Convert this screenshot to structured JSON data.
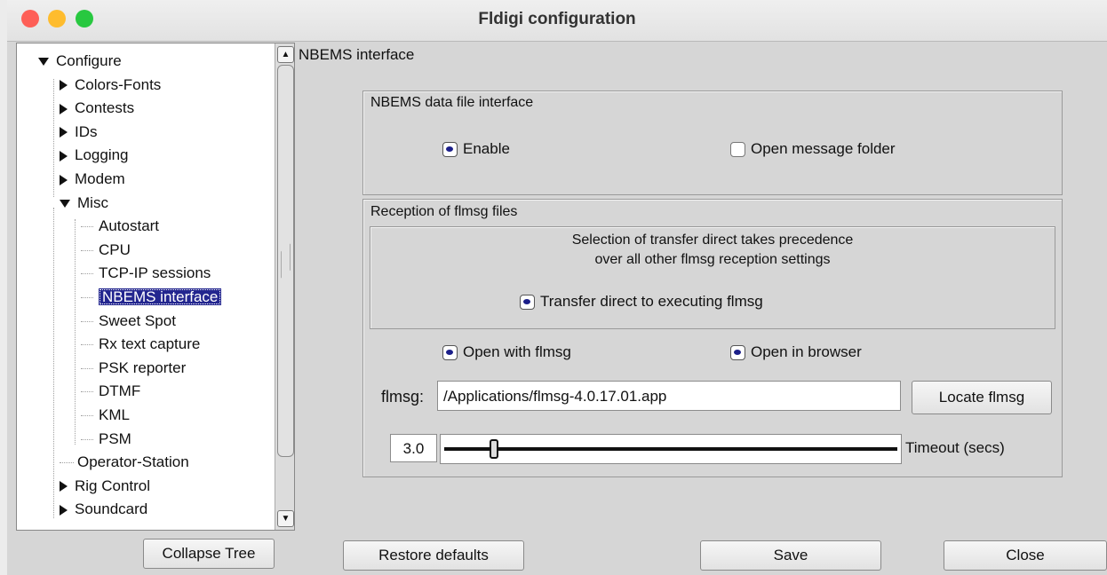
{
  "window": {
    "title": "Fldigi configuration"
  },
  "tree": {
    "items": [
      {
        "label": "Configure",
        "level": 0,
        "expander": "down"
      },
      {
        "label": "Colors-Fonts",
        "level": 1,
        "expander": "right"
      },
      {
        "label": "Contests",
        "level": 1,
        "expander": "right"
      },
      {
        "label": "IDs",
        "level": 1,
        "expander": "right"
      },
      {
        "label": "Logging",
        "level": 1,
        "expander": "right"
      },
      {
        "label": "Modem",
        "level": 1,
        "expander": "right"
      },
      {
        "label": "Misc",
        "level": 1,
        "expander": "down"
      },
      {
        "label": "Autostart",
        "level": 2
      },
      {
        "label": "CPU",
        "level": 2
      },
      {
        "label": "TCP-IP sessions",
        "level": 2
      },
      {
        "label": "NBEMS interface",
        "level": 2,
        "selected": true
      },
      {
        "label": "Sweet Spot",
        "level": 2
      },
      {
        "label": "Rx text capture",
        "level": 2
      },
      {
        "label": "PSK reporter",
        "level": 2
      },
      {
        "label": "DTMF",
        "level": 2
      },
      {
        "label": "KML",
        "level": 2
      },
      {
        "label": "PSM",
        "level": 2
      },
      {
        "label": "Operator-Station",
        "level": 1
      },
      {
        "label": "Rig Control",
        "level": 1,
        "expander": "right"
      },
      {
        "label": "Soundcard",
        "level": 1,
        "expander": "right"
      }
    ]
  },
  "panel": {
    "section_title": "NBEMS interface",
    "data_file_group": {
      "label": "NBEMS data file interface",
      "enable_label": "Enable",
      "enable_checked": true,
      "open_folder_label": "Open message folder",
      "open_folder_checked": false
    },
    "reception_group": {
      "label": "Reception of flmsg files",
      "note_line1": "Selection of transfer direct takes precedence",
      "note_line2": "over all other flmsg reception settings",
      "transfer_label": "Transfer direct to executing flmsg",
      "transfer_checked": true,
      "open_flmsg_label": "Open with flmsg",
      "open_flmsg_checked": true,
      "open_browser_label": "Open in browser",
      "open_browser_checked": true,
      "flmsg_label": "flmsg:",
      "flmsg_path": "/Applications/flmsg-4.0.17.01.app",
      "locate_label": "Locate flmsg",
      "timeout_value": "3.0",
      "timeout_label": "Timeout (secs)"
    }
  },
  "buttons": {
    "collapse": "Collapse Tree",
    "restore": "Restore defaults",
    "save": "Save",
    "close": "Close"
  },
  "colors": {
    "close_light": "#fe5f57",
    "minimize_light": "#febc2e",
    "zoom_light": "#28c840",
    "selection": "#23268f"
  }
}
